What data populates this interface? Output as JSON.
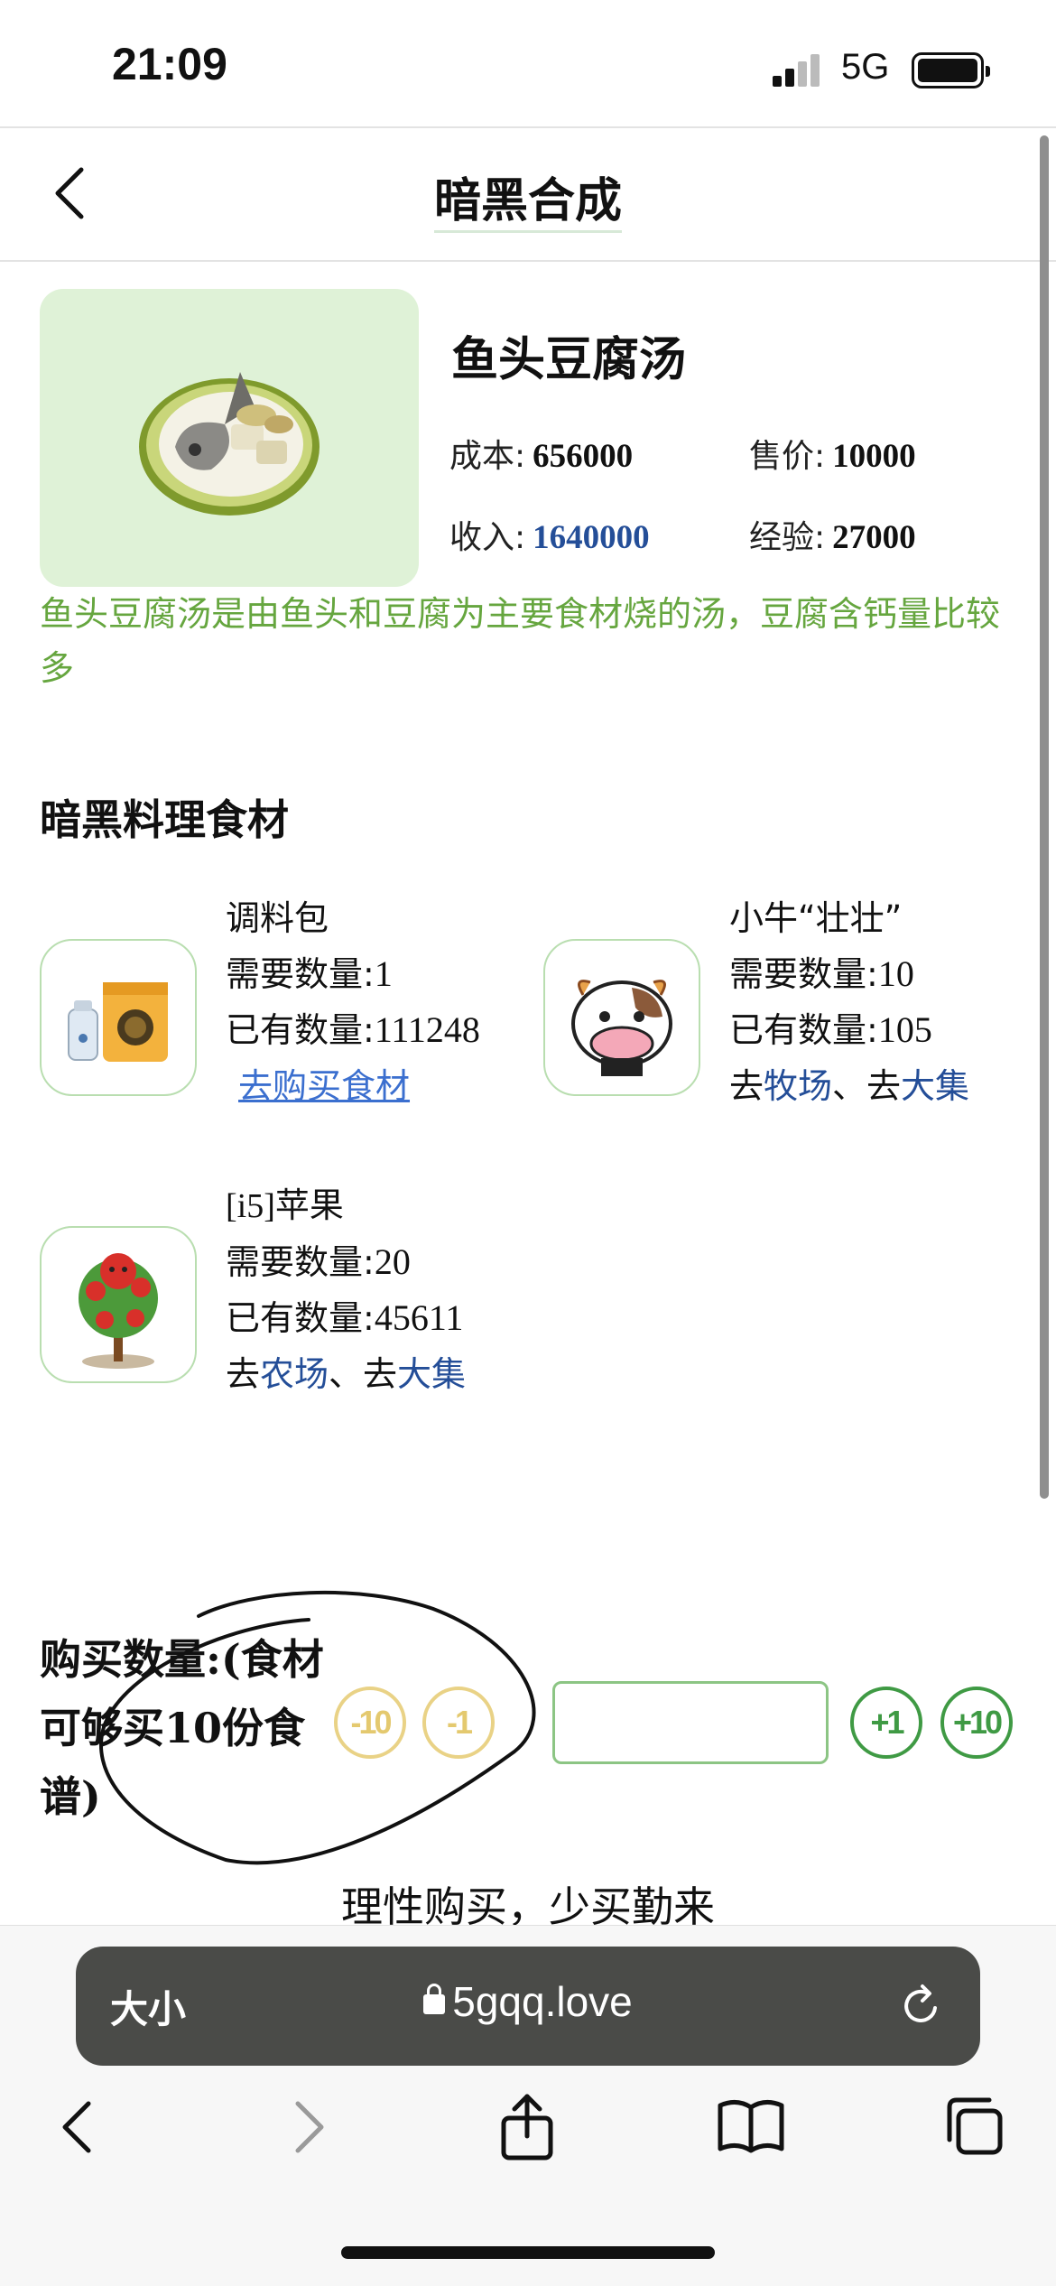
{
  "status_bar": {
    "time": "21:09",
    "network": "5G"
  },
  "nav": {
    "title": "暗黑合成"
  },
  "dish": {
    "name": "鱼头豆腐汤",
    "cost_label": "成本:",
    "cost": "656000",
    "price_label": "售价:",
    "price": "10000",
    "income_label": "收入:",
    "income": "1640000",
    "exp_label": "经验:",
    "exp": "27000",
    "description": "鱼头豆腐汤是由鱼头和豆腐为主要食材烧的汤，豆腐含钙量比较多"
  },
  "ingredients_title": "暗黑料理食材",
  "ingredients": [
    {
      "name": "调料包",
      "need_label": "需要数量:",
      "need": "1",
      "have_label": "已有数量:",
      "have": "111248",
      "buy_link": "去购买食材"
    },
    {
      "name": "小牛“壮壮”",
      "need_label": "需要数量:",
      "need": "10",
      "have_label": "已有数量:",
      "have": "105",
      "go1": "去",
      "link1": "牧场",
      "sep": "、去",
      "link2": "大集"
    },
    {
      "name": "[i5]苹果",
      "need_label": "需要数量:",
      "need": "20",
      "have_label": "已有数量:",
      "have": "45611",
      "go1": "去",
      "link1": "农场",
      "sep": "、去",
      "link2": "大集"
    }
  ],
  "buy": {
    "label": "购买数量:(食材可够买10份食谱)",
    "minus10": "-10",
    "minus1": "-1",
    "plus1": "+1",
    "plus10": "+10",
    "input_value": ""
  },
  "footer_text": "理性购买，少买勤来",
  "browser": {
    "size_label": "大小",
    "url": "5gqq.love"
  }
}
